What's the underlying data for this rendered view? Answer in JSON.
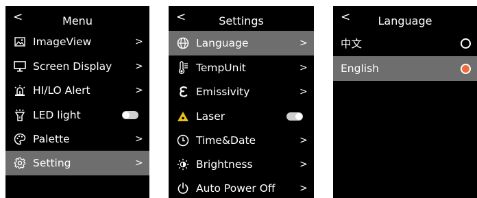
{
  "screens": {
    "menu": {
      "back": "<",
      "title": "Menu",
      "items": [
        {
          "label": "ImageView",
          "icon": "image-icon",
          "control": "chevron",
          "selected": false
        },
        {
          "label": "Screen Display",
          "icon": "monitor-icon",
          "control": "chevron",
          "selected": false
        },
        {
          "label": "HI/LO Alert",
          "icon": "alarm-light-icon",
          "control": "chevron",
          "selected": false
        },
        {
          "label": "LED light",
          "icon": "flashlight-icon",
          "control": "toggle",
          "toggle_on": false,
          "selected": false
        },
        {
          "label": "Palette",
          "icon": "palette-icon",
          "control": "chevron",
          "selected": false
        },
        {
          "label": "Setting",
          "icon": "gear-icon",
          "control": "chevron",
          "selected": true
        }
      ]
    },
    "settings": {
      "back": "<",
      "title": "Settings",
      "items": [
        {
          "label": "Language",
          "icon": "globe-icon",
          "control": "chevron",
          "selected": true
        },
        {
          "label": "TempUnit",
          "icon": "thermometer-icon",
          "control": "chevron",
          "selected": false
        },
        {
          "label": "Emissivity",
          "icon": "epsilon-icon",
          "control": "chevron",
          "selected": false
        },
        {
          "label": "Laser",
          "icon": "laser-warning-icon",
          "control": "toggle",
          "toggle_on": true,
          "selected": false
        },
        {
          "label": "Time&Date",
          "icon": "clock-icon",
          "control": "chevron",
          "selected": false
        },
        {
          "label": "Brightness",
          "icon": "brightness-icon",
          "control": "chevron",
          "selected": false
        },
        {
          "label": "Auto Power Off",
          "icon": "power-icon",
          "control": "chevron",
          "selected": false
        }
      ]
    },
    "language": {
      "back": "<",
      "title": "Language",
      "options": [
        {
          "label": "中文",
          "checked": false,
          "selected": false
        },
        {
          "label": "English",
          "checked": true,
          "selected": true
        }
      ]
    }
  },
  "chevron": ">",
  "colors": {
    "background": "#000000",
    "selected_row": "#6e6e6e",
    "radio_checked": "#f06a3c",
    "laser_icon": "#e8c21a",
    "toggle_track": "#cfcfcf"
  }
}
